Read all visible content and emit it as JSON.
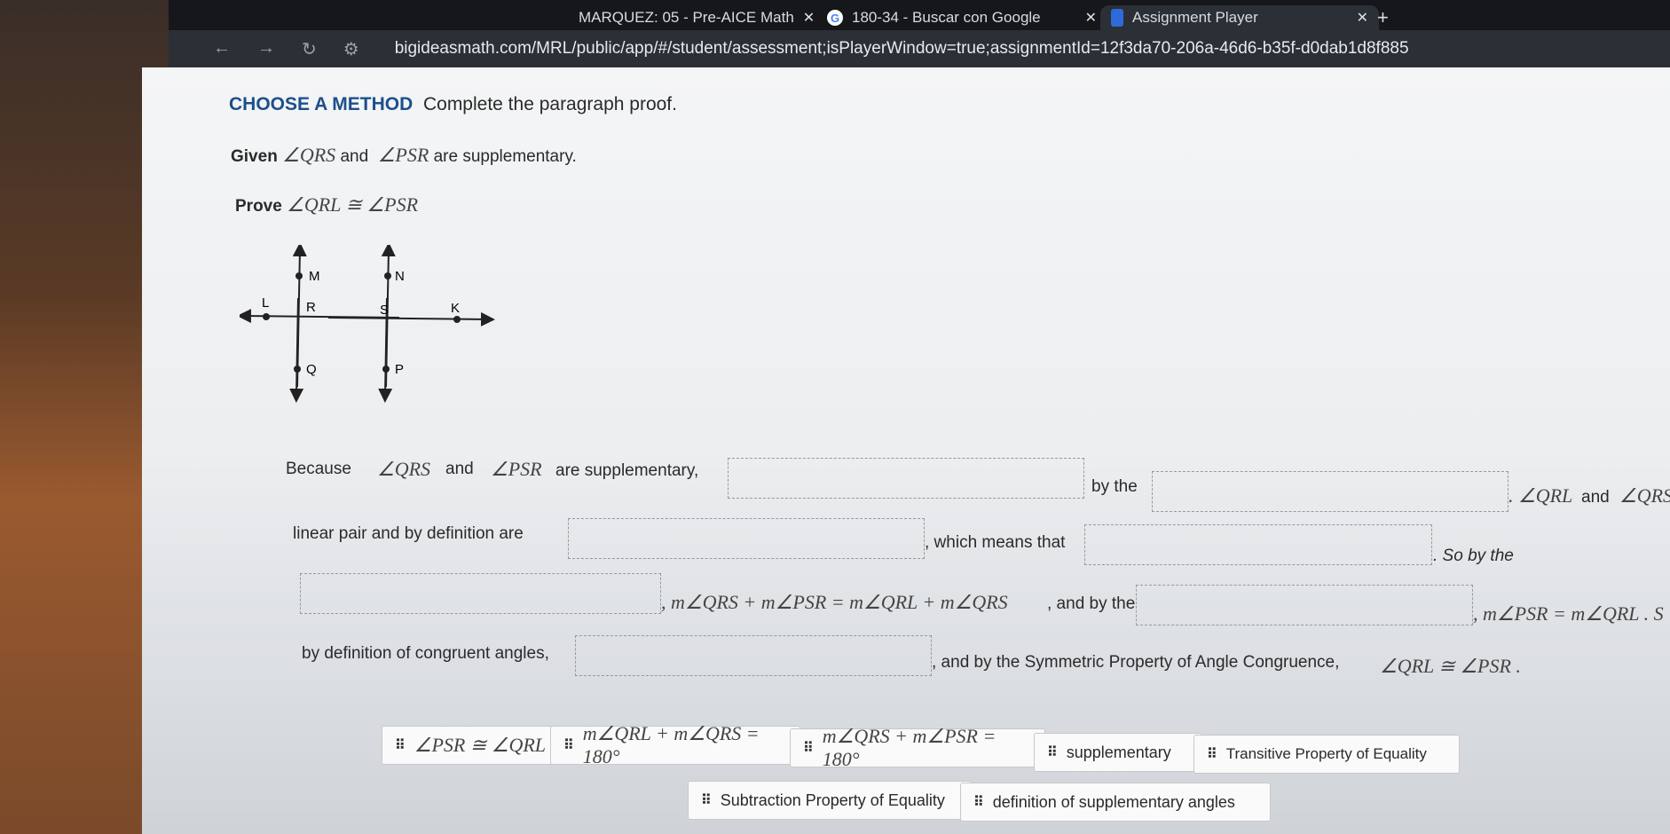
{
  "browser": {
    "tabs": [
      {
        "label": "MARQUEZ: 05 - Pre-AICE Math",
        "icon": "site-icon"
      },
      {
        "label": "180-34 - Buscar con Google",
        "icon": "google-icon"
      },
      {
        "label": "Assignment Player",
        "icon": "bigideas-icon",
        "active": true
      }
    ],
    "close": "✕",
    "new_tab": "+",
    "url": "bigideasmath.com/MRL/public/app/#/student/assessment;isPlayerWindow=true;assignmentId=12f3da70-206a-46d6-b35f-d0dab1d8f885"
  },
  "question": {
    "method": "CHOOSE A METHOD",
    "instruction": "Complete the paragraph proof.",
    "given_label": "Given",
    "given_a": "∠QRS",
    "given_and": "and",
    "given_b": "∠PSR",
    "given_rest": "are supplementary.",
    "prove_label": "Prove",
    "prove_stmt": "∠QRL ≅ ∠PSR"
  },
  "figure": {
    "labels": [
      "M",
      "N",
      "L",
      "R",
      "S",
      "K",
      "Q",
      "P"
    ]
  },
  "proof": {
    "l1a": "Because",
    "l1b": "∠QRS",
    "l1c": "and",
    "l1d": "∠PSR",
    "l1e": "are supplementary,",
    "l1f": "by the",
    "l1g": ". ∠QRL",
    "l1h": "and",
    "l1i": "∠QRS",
    "l2a": "linear pair and by definition are",
    "l2b": ", which means that",
    "l2c": ". So by the",
    "l3a": ", m∠QRS + m∠PSR = m∠QRL + m∠QRS",
    "l3b": ", and by the",
    "l3c": ", m∠PSR = m∠QRL . S",
    "l4a": "by definition of congruent angles,",
    "l4b": ", and by the Symmetric Property of Angle Congruence,",
    "l4c": "∠QRL ≅ ∠PSR ."
  },
  "choices": [
    {
      "label": "∠PSR ≅ ∠QRL",
      "math": true
    },
    {
      "label": "m∠QRL + m∠QRS = 180°",
      "math": true
    },
    {
      "label": "m∠QRS + m∠PSR = 180°",
      "math": true
    },
    {
      "label": "supplementary",
      "math": false
    },
    {
      "label": "Transitive Property of Equality",
      "math": false
    },
    {
      "label": "Subtraction Property of Equality",
      "math": false
    },
    {
      "label": "definition of supplementary angles",
      "math": false
    }
  ],
  "grip": "⠿"
}
